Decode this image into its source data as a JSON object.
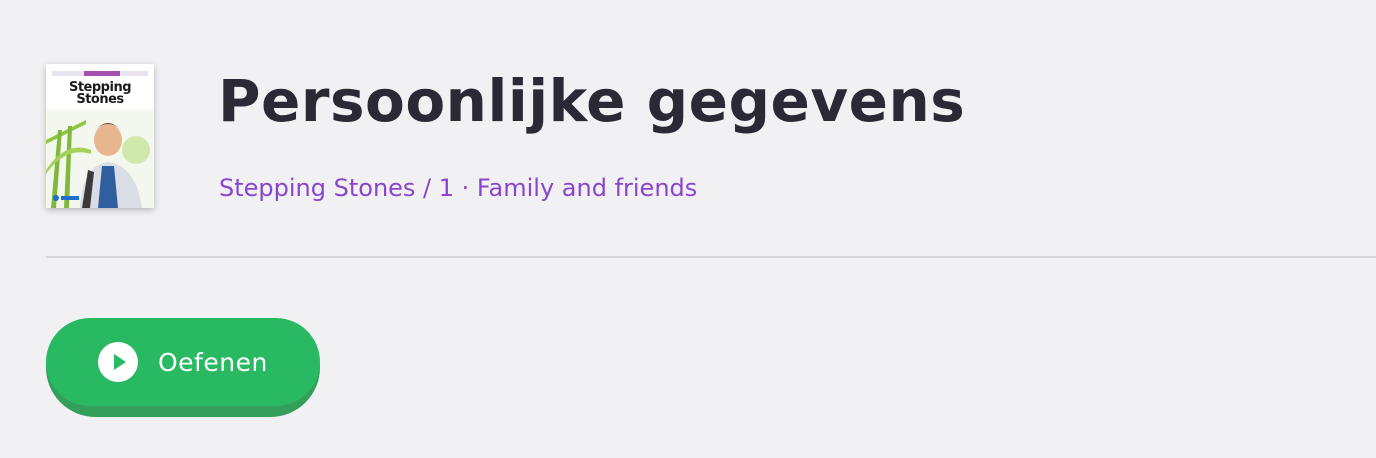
{
  "header": {
    "title": "Persoonlijke gegevens",
    "breadcrumb": "Stepping Stones / 1 · Family and friends",
    "book_cover": {
      "title_line1": "Stepping",
      "title_line2": "Stones"
    }
  },
  "actions": {
    "practice_label": "Oefenen",
    "practice_icon": "play-icon"
  },
  "colors": {
    "background": "#f1f1f4",
    "title": "#2b2935",
    "breadcrumb": "#8a45cf",
    "button": "#2ab963",
    "button_shadow": "#339f5a",
    "divider": "#d6d6db"
  }
}
